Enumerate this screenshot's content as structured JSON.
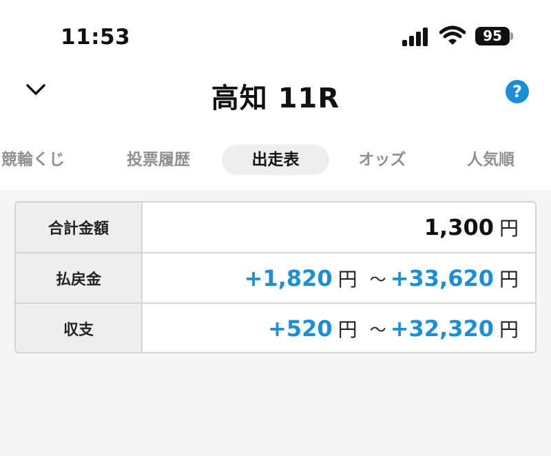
{
  "status_bar": {
    "time": "11:53",
    "battery": "95"
  },
  "header": {
    "title": "高知 11R",
    "help_label": "?"
  },
  "tabs": [
    {
      "label": "競輪くじ"
    },
    {
      "label": "投票履歴"
    },
    {
      "label": "出走表",
      "active": true
    },
    {
      "label": "オッズ"
    },
    {
      "label": "人気順"
    }
  ],
  "summary": {
    "total": {
      "label": "合計金額",
      "value": "1,300",
      "unit": "円"
    },
    "payout": {
      "label": "払戻金",
      "min": "+1,820",
      "min_unit": "円",
      "tilde": "～",
      "max": "+33,620",
      "max_unit": "円"
    },
    "balance": {
      "label": "収支",
      "min": "+520",
      "min_unit": "円",
      "tilde": "～",
      "max": "+32,320",
      "max_unit": "円"
    }
  },
  "colors": {
    "accent": "#1a8fd8",
    "tab_active_bg": "#eeeeee",
    "label_bg": "#eeeeee"
  }
}
